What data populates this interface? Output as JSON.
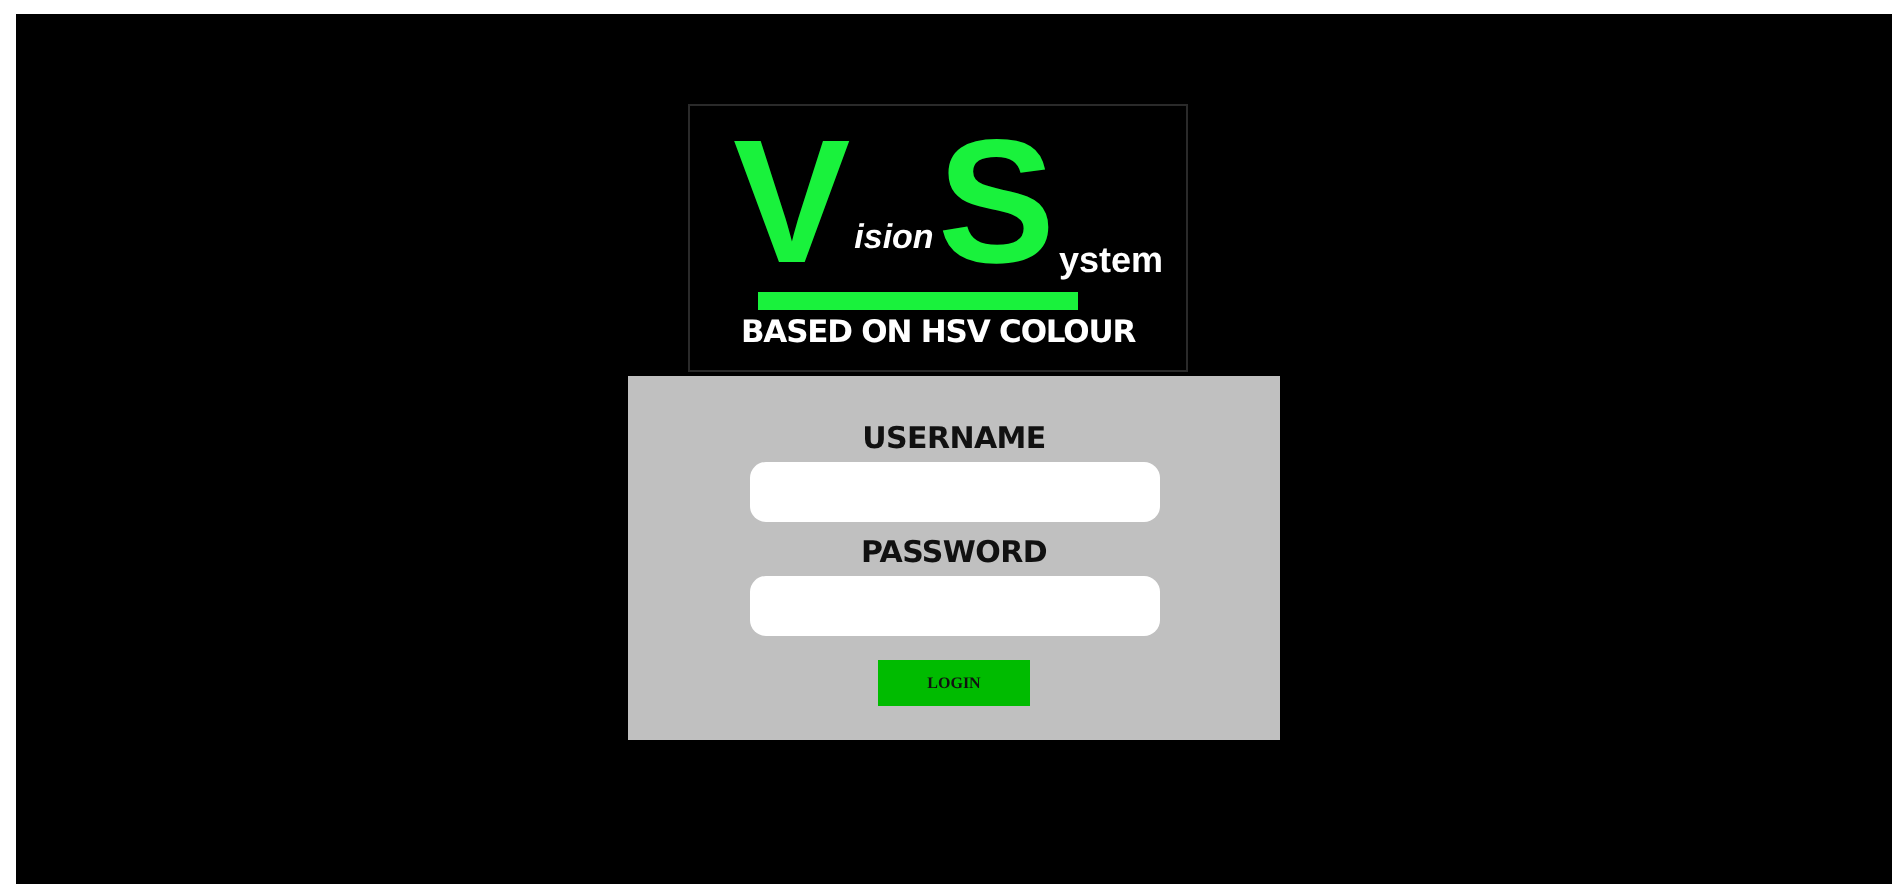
{
  "logo": {
    "letter_1": "V",
    "word_1": "ision",
    "letter_2": "S",
    "word_2": "ystem",
    "tagline": "BASED ON HSV COLOUR"
  },
  "login_form": {
    "fields": [
      {
        "label": "USERNAME"
      },
      {
        "label": "PASSWORD"
      }
    ],
    "button": "LOGIN"
  }
}
